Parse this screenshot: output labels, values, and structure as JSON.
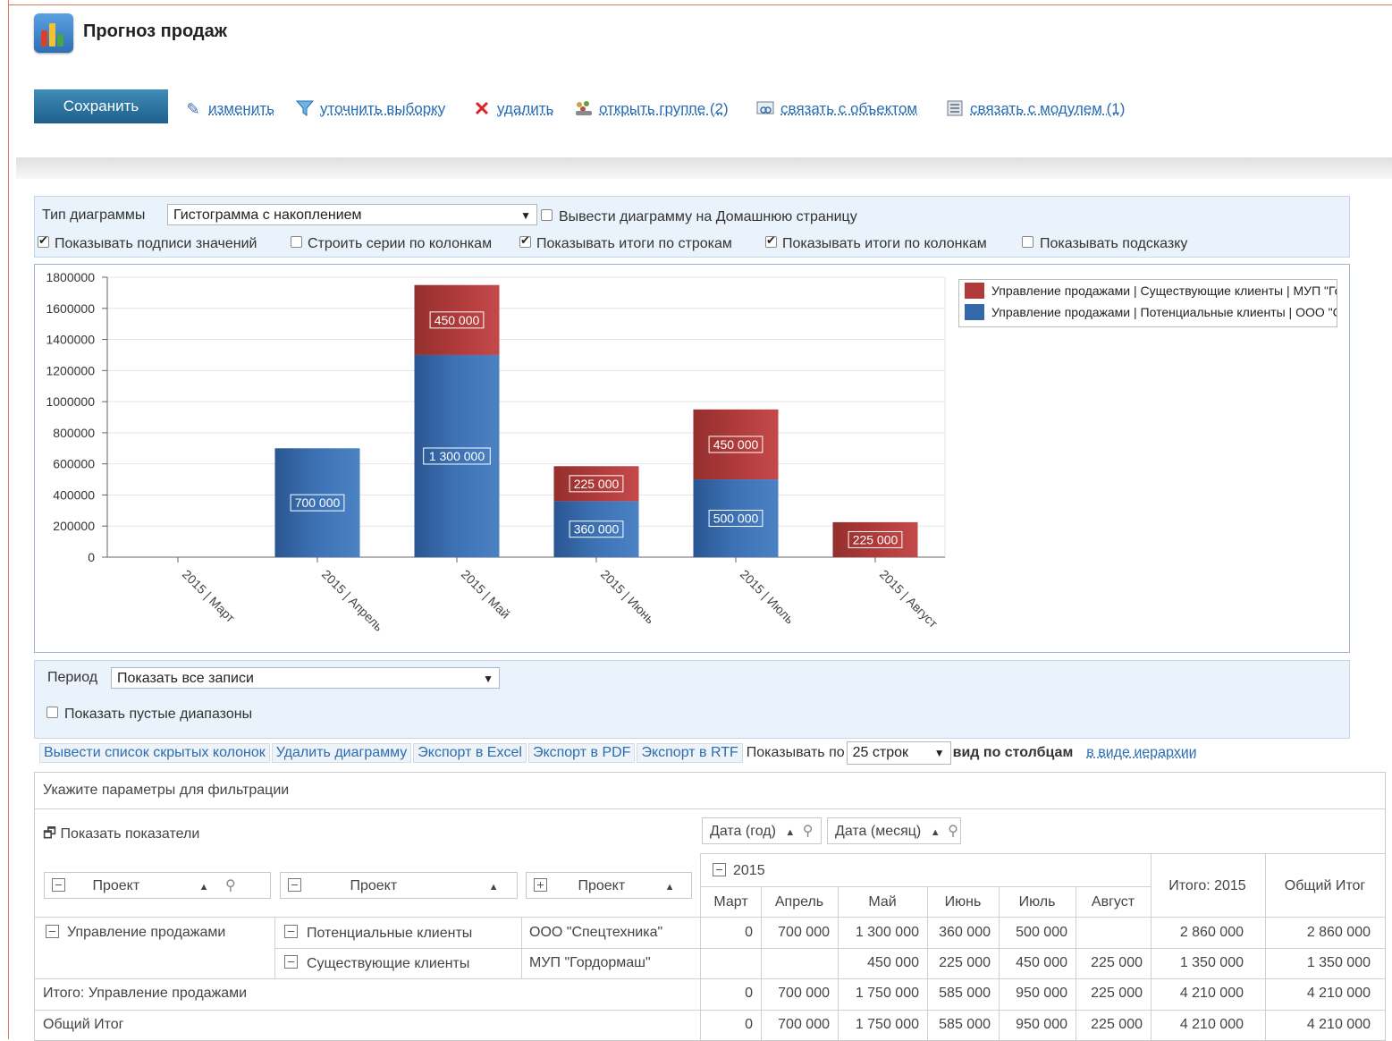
{
  "header": {
    "title": "Прогноз продаж",
    "save_label": "Сохранить",
    "actions": [
      {
        "label": "изменить",
        "icon": "pencil-icon"
      },
      {
        "label": "уточнить выборку",
        "icon": "funnel-icon"
      },
      {
        "label": "удалить",
        "icon": "delete-x-icon"
      },
      {
        "label": "открыть группе (2)",
        "icon": "group-icon"
      },
      {
        "label": "связать с объектом",
        "icon": "link-object-icon"
      },
      {
        "label": "связать с модулем (1)",
        "icon": "link-module-icon"
      }
    ]
  },
  "chart_settings": {
    "type_label": "Тип диаграммы",
    "type_value": "Гистограмма с накоплением",
    "home_page": {
      "label": "Вывести диаграмму на Домашнюю страницу",
      "checked": false
    },
    "show_value_labels": {
      "label": "Показывать подписи значений",
      "checked": true
    },
    "series_by_columns": {
      "label": "Строить серии по колонкам",
      "checked": false
    },
    "row_totals": {
      "label": "Показывать итоги по строкам",
      "checked": true
    },
    "column_totals": {
      "label": "Показывать итоги по колонкам",
      "checked": true
    },
    "tooltip": {
      "label": "Показывать подсказку",
      "checked": false
    }
  },
  "chart_data": {
    "type": "bar",
    "stacked": true,
    "categories": [
      "2015 | Март",
      "2015 | Апрель",
      "2015 | Май",
      "2015 | Июнь",
      "2015 | Июль",
      "2015 | Август"
    ],
    "series": [
      {
        "name": "Управление продажами | Потенциальные клиенты | ООО \"Спецтехника\"",
        "color": "#3568a8",
        "values": [
          0,
          700000,
          1300000,
          360000,
          500000,
          0
        ],
        "labels": [
          "",
          "700 000",
          "1 300 000",
          "360 000",
          "500 000",
          ""
        ]
      },
      {
        "name": "Управление продажами | Существующие клиенты | МУП \"Гордормаш\"",
        "color": "#b03a3a",
        "values": [
          0,
          0,
          450000,
          225000,
          450000,
          225000
        ],
        "labels": [
          "",
          "",
          "450 000",
          "225 000",
          "450 000",
          "225 000"
        ]
      }
    ],
    "legend_order": [
      1,
      0
    ],
    "y_ticks": [
      "0",
      "200000",
      "400000",
      "600000",
      "800000",
      "1000000",
      "1200000",
      "1400000",
      "1600000",
      "1800000"
    ],
    "ylim": [
      0,
      1800000
    ],
    "grid": true,
    "legend_position": "top-right"
  },
  "period": {
    "label": "Период",
    "value": "Показать все записи",
    "empty_ranges": {
      "label": "Показать пустые диапазоны",
      "checked": false
    }
  },
  "toolbar2": {
    "buttons": [
      "Вывести список скрытых колонок",
      "Удалить диаграмму",
      "Экспорт в Excel",
      "Экспорт в PDF",
      "Экспорт в RTF"
    ],
    "show_by_label": "Показывать по",
    "rows_value": "25 строк",
    "view_columns": "вид по столбцам",
    "view_hierarchy": "в виде иерархии"
  },
  "pivot": {
    "filter_hint": "Укажите параметры для фильтрации",
    "show_indicators": "Показать показатели",
    "col_fields": [
      "Дата (год)",
      "Дата (месяц)"
    ],
    "row_fields": [
      "Проект",
      "Проект",
      "Проект"
    ],
    "year": "2015",
    "months": [
      "Март",
      "Апрель",
      "Май",
      "Июнь",
      "Июль",
      "Август"
    ],
    "total_year": "Итого: 2015",
    "grand_total_col": "Общий Итог",
    "group": "Управление продажами",
    "rows": [
      {
        "sub": "Потенциальные клиенты",
        "client": "ООО \"Спецтехника\"",
        "values": [
          "0",
          "700 000",
          "1 300 000",
          "360 000",
          "500 000",
          "",
          "2 860 000",
          "2 860 000"
        ]
      },
      {
        "sub": "Существующие клиенты",
        "client": "МУП \"Гордормаш\"",
        "values": [
          "",
          "",
          "450 000",
          "225 000",
          "450 000",
          "225 000",
          "1 350 000",
          "1 350 000"
        ]
      }
    ],
    "subtotal": {
      "label": "Итого: Управление продажами",
      "values": [
        "0",
        "700 000",
        "1 750 000",
        "585 000",
        "950 000",
        "225 000",
        "4 210 000",
        "4 210 000"
      ]
    },
    "grand_total": {
      "label": "Общий Итог",
      "values": [
        "0",
        "700 000",
        "1 750 000",
        "585 000",
        "950 000",
        "225 000",
        "4 210 000",
        "4 210 000"
      ]
    }
  }
}
